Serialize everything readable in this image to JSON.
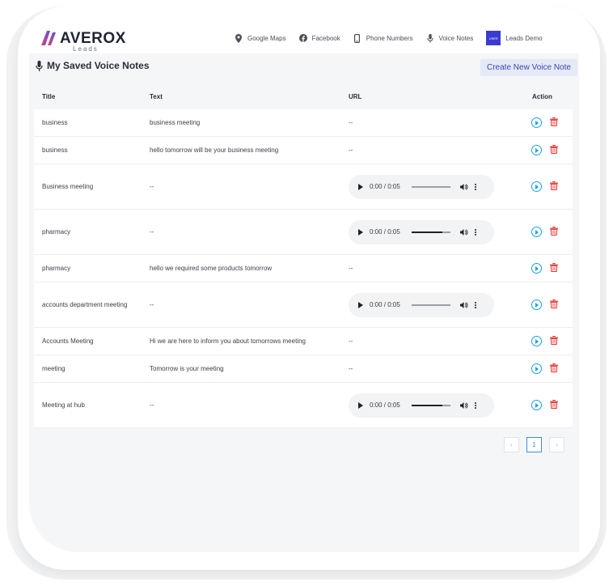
{
  "header": {
    "logo": {
      "brand": "AVEROX",
      "sub": "Leads"
    },
    "nav": [
      {
        "label": "Google Maps",
        "icon": "map-pin-icon"
      },
      {
        "label": "Facebook",
        "icon": "facebook-icon"
      },
      {
        "label": "Phone Numbers",
        "icon": "phone-icon"
      },
      {
        "label": "Voice Notes",
        "icon": "microphone-icon"
      }
    ],
    "user": {
      "badge": "USER",
      "name": "Leads Demo"
    }
  },
  "page": {
    "title": "My Saved Voice Notes",
    "create_button": "Create New Voice Note"
  },
  "table": {
    "headers": {
      "title": "Title",
      "text": "Text",
      "url": "URL",
      "action": "Action"
    },
    "rows": [
      {
        "title": "business",
        "text": "business meeting",
        "url": "--",
        "audio": null
      },
      {
        "title": "business",
        "text": "hello tomorrow will be your business meeting",
        "url": "--",
        "audio": null
      },
      {
        "title": "Business meeting",
        "text": "--",
        "url": "",
        "audio": {
          "time": "0:00 / 0:05",
          "progress": 0
        }
      },
      {
        "title": "pharmacy",
        "text": "--",
        "url": "",
        "audio": {
          "time": "0:00 / 0:05",
          "progress": 0.8
        }
      },
      {
        "title": "pharmacy",
        "text": "hello we required some products tomorrow",
        "url": "--",
        "audio": null
      },
      {
        "title": "accounts department meeting",
        "text": "--",
        "url": "",
        "audio": {
          "time": "0:00 / 0:05",
          "progress": 0
        }
      },
      {
        "title": "Accounts Meeting",
        "text": "Hi we are here to inform you about tomorrows meeting",
        "url": "--",
        "audio": null
      },
      {
        "title": "meeting",
        "text": "Tomorrow is your meeting",
        "url": "--",
        "audio": null
      },
      {
        "title": "Meeting at hub",
        "text": "--",
        "url": "",
        "audio": {
          "time": "0:00 / 0:05",
          "progress": 0.8
        }
      }
    ]
  },
  "pagination": {
    "prev": "‹",
    "current": "1",
    "next": "›"
  },
  "colors": {
    "accent": "#3a48b5",
    "play": "#1aa0e6",
    "delete": "#e53935",
    "badge": "#3b3bd1"
  }
}
